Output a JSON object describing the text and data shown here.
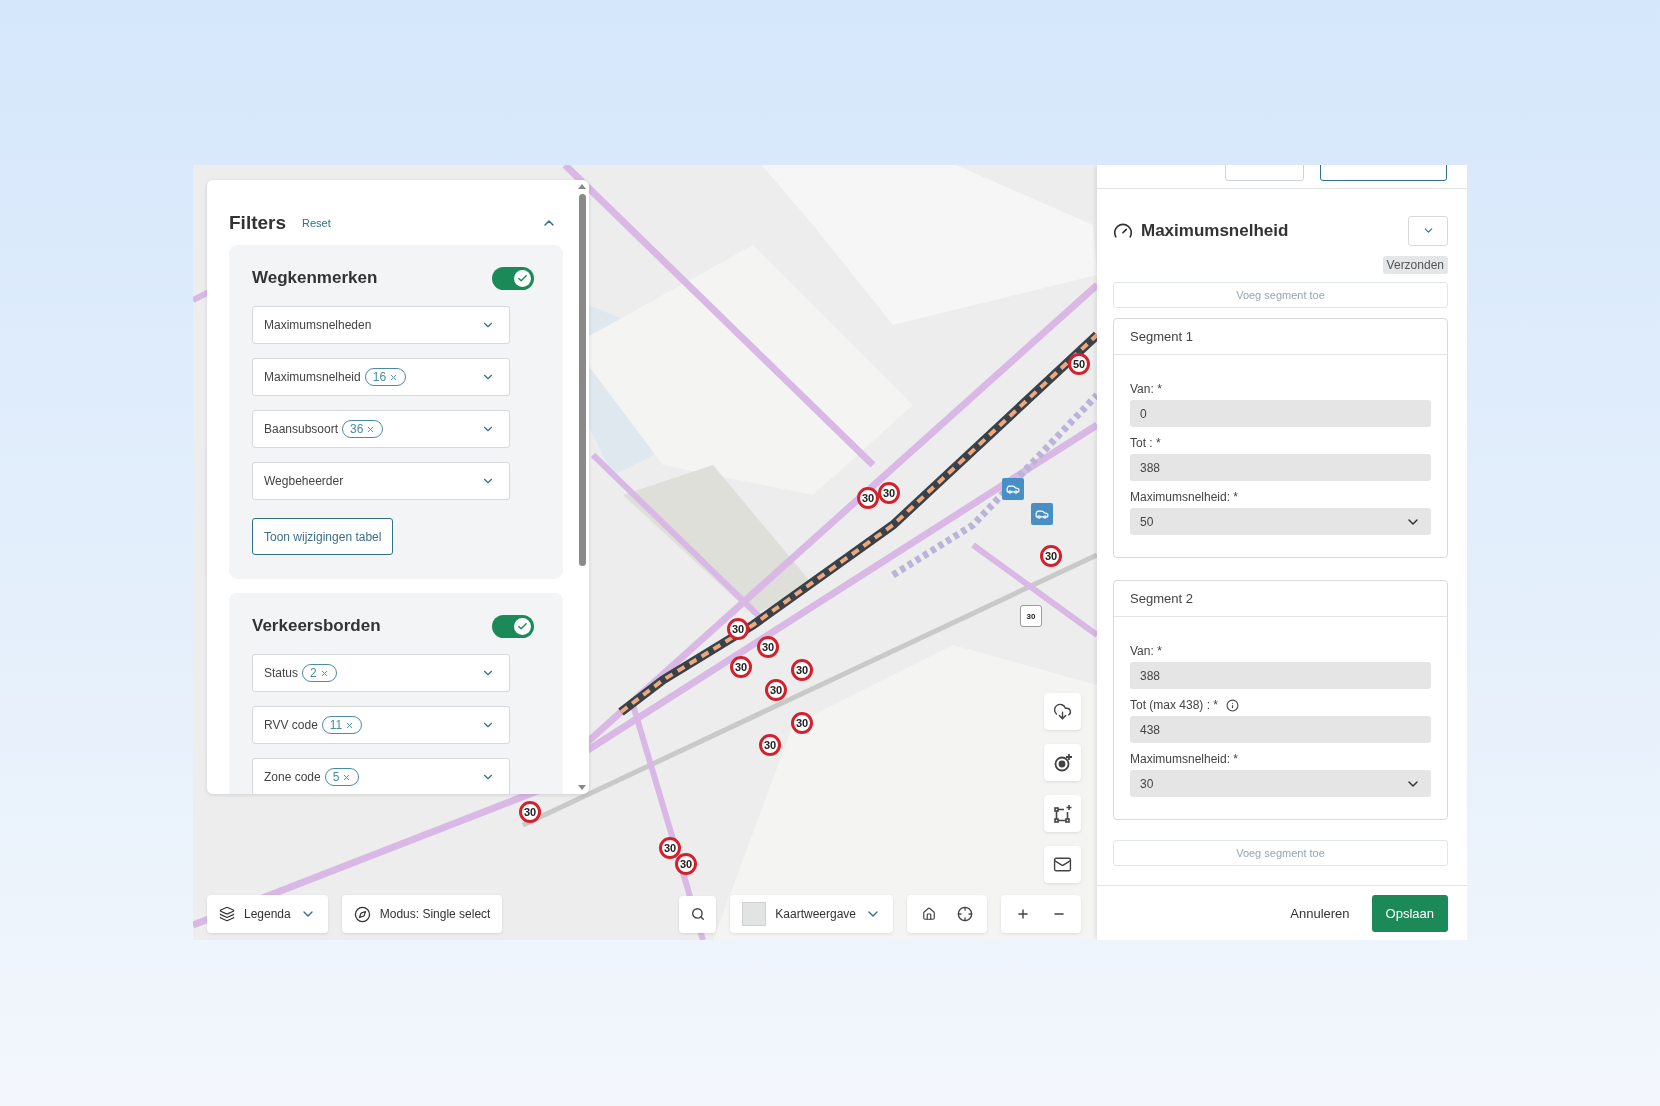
{
  "filters": {
    "title": "Filters",
    "reset": "Reset",
    "expanded": true,
    "sections": [
      {
        "title": "Wegkenmerken",
        "on": true,
        "dropdowns": [
          {
            "label": "Maximumsnelheden"
          },
          {
            "label": "Maximumsnelheid",
            "chip": "16"
          },
          {
            "label": "Baansubsoort",
            "chip": "36"
          },
          {
            "label": "Wegbeheerder"
          }
        ],
        "button": "Toon wijzigingen tabel"
      },
      {
        "title": "Verkeersborden",
        "on": true,
        "dropdowns": [
          {
            "label": "Status",
            "chip": "2"
          },
          {
            "label": "RVV code",
            "chip": "11"
          },
          {
            "label": "Zone code",
            "chip": "5"
          }
        ]
      }
    ]
  },
  "map": {
    "markers": [
      {
        "kind": "round",
        "value": "30"
      },
      {
        "kind": "round",
        "value": "30"
      },
      {
        "kind": "round",
        "value": "30"
      },
      {
        "kind": "round",
        "value": "30"
      },
      {
        "kind": "round",
        "value": "30"
      },
      {
        "kind": "round",
        "value": "30"
      },
      {
        "kind": "round",
        "value": "30"
      },
      {
        "kind": "round",
        "value": "30"
      },
      {
        "kind": "round",
        "value": "30"
      },
      {
        "kind": "round",
        "value": "30"
      },
      {
        "kind": "round",
        "value": "50"
      },
      {
        "kind": "round",
        "value": "30"
      },
      {
        "kind": "round",
        "value": "30"
      },
      {
        "kind": "round",
        "value": "30"
      },
      {
        "kind": "square",
        "value": "30"
      }
    ]
  },
  "toolbar": {
    "legend": "Legenda",
    "mode": "Modus: Single select",
    "view": "Kaartweergave"
  },
  "detail": {
    "title": "Maximumsnelheid",
    "status": "Verzonden",
    "add_segment_top": {
      "label": "Voeg segment toe",
      "disabled": true
    },
    "segments": [
      {
        "title": "Segment 1",
        "fields": [
          {
            "kind": "input",
            "label": "Van: *",
            "value": "0"
          },
          {
            "kind": "input",
            "label": "Tot : *",
            "value": "388"
          },
          {
            "kind": "select",
            "label": "Maximumsnelheid: *",
            "value": "50"
          }
        ]
      },
      {
        "title": "Segment 2",
        "fields": [
          {
            "kind": "input",
            "label": "Van: *",
            "value": "388"
          },
          {
            "kind": "input",
            "label": "Tot (max 438) : *",
            "value": "438",
            "info": true
          },
          {
            "kind": "select",
            "label": "Maximumsnelheid: *",
            "value": "30"
          }
        ]
      }
    ],
    "add_segment_bottom": {
      "label": "Voeg segment toe",
      "disabled": true
    },
    "cancel": "Annuleren",
    "save": "Opslaan"
  }
}
